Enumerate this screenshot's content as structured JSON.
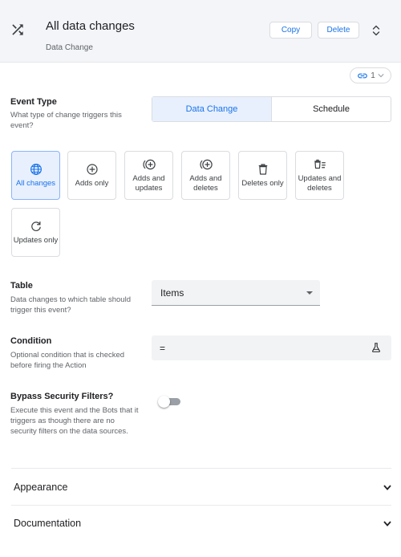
{
  "header": {
    "title": "All data changes",
    "subtitle": "Data Change",
    "copy_label": "Copy",
    "delete_label": "Delete"
  },
  "links": {
    "count": "1"
  },
  "event_type": {
    "label": "Event Type",
    "description": "What type of change triggers this event?",
    "options": [
      "Data Change",
      "Schedule"
    ],
    "selected": "Data Change"
  },
  "change_types": [
    {
      "label": "All changes",
      "icon": "globe-icon",
      "selected": true
    },
    {
      "label": "Adds only",
      "icon": "add-circle-icon",
      "selected": false
    },
    {
      "label": "Adds and updates",
      "icon": "add-update-icon",
      "selected": false
    },
    {
      "label": "Adds and deletes",
      "icon": "add-delete-icon",
      "selected": false
    },
    {
      "label": "Deletes only",
      "icon": "trash-icon",
      "selected": false
    },
    {
      "label": "Updates and deletes",
      "icon": "trash-list-icon",
      "selected": false
    },
    {
      "label": "Updates only",
      "icon": "refresh-icon",
      "selected": false
    }
  ],
  "table": {
    "label": "Table",
    "description": "Data changes to which table should trigger this event?",
    "value": "Items"
  },
  "condition": {
    "label": "Condition",
    "description": "Optional condition that is checked before firing the Action",
    "value": "="
  },
  "bypass": {
    "label": "Bypass Security Filters?",
    "description": "Execute this event and the Bots that it triggers as though there are no security filters on the data sources.",
    "enabled": false
  },
  "sections": {
    "appearance": "Appearance",
    "documentation": "Documentation"
  },
  "colors": {
    "accent": "#1a73e8",
    "selected_bg": "#e8f0fe",
    "header_bg": "#f3f5f8"
  }
}
